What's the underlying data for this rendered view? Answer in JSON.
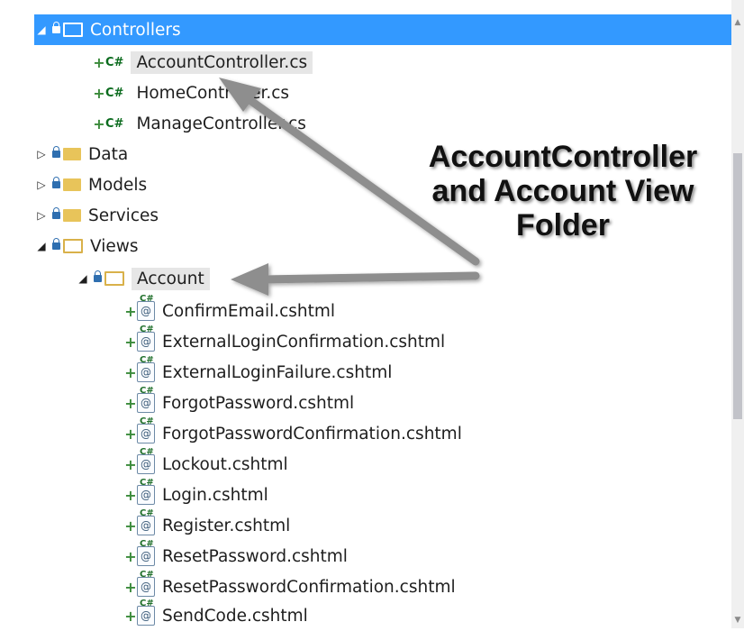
{
  "tree": {
    "controllers": {
      "label": "Controllers",
      "files": [
        {
          "type_icon": "C#",
          "label": "AccountController.cs"
        },
        {
          "type_icon": "C#",
          "label": "HomeController.cs"
        },
        {
          "type_icon": "C#",
          "label": "ManageController.cs"
        }
      ]
    },
    "folders_collapsed": [
      {
        "label": "Data"
      },
      {
        "label": "Models"
      },
      {
        "label": "Services"
      }
    ],
    "views": {
      "label": "Views",
      "account": {
        "label": "Account",
        "files": [
          {
            "label": "ConfirmEmail.cshtml"
          },
          {
            "label": "ExternalLoginConfirmation.cshtml"
          },
          {
            "label": "ExternalLoginFailure.cshtml"
          },
          {
            "label": "ForgotPassword.cshtml"
          },
          {
            "label": "ForgotPasswordConfirmation.cshtml"
          },
          {
            "label": "Lockout.cshtml"
          },
          {
            "label": "Login.cshtml"
          },
          {
            "label": "Register.cshtml"
          },
          {
            "label": "ResetPassword.cshtml"
          },
          {
            "label": "ResetPasswordConfirmation.cshtml"
          },
          {
            "label": "SendCode.cshtml"
          }
        ]
      }
    }
  },
  "callout": {
    "line1": "AccountController",
    "line2": "and Account View",
    "line3": "Folder"
  },
  "icons": {
    "expand_open": "triangle-down-icon",
    "expand_closed": "triangle-right-icon",
    "file_add": "plus-icon",
    "cs_file": "csharp-icon",
    "razor_file": "razor-icon"
  },
  "colors": {
    "selection": "#3399ff",
    "folder": "#e8c45a",
    "arrow": "#8e8e8e"
  }
}
